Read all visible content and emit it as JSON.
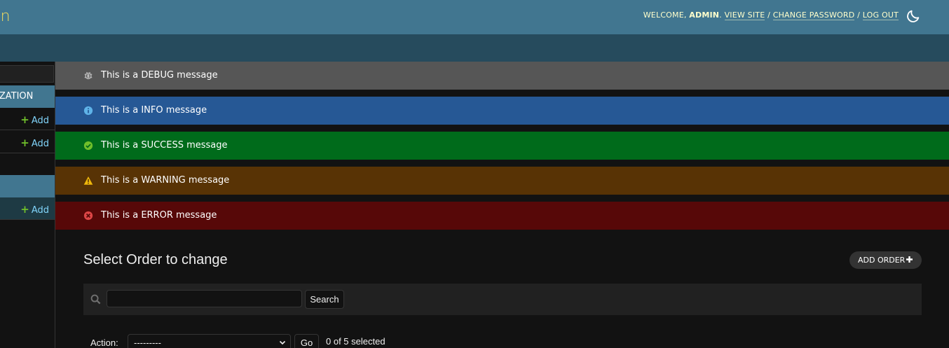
{
  "header": {
    "branding": "Django administration",
    "branding_visible": "ation",
    "welcome": "Welcome,",
    "username": "admin",
    "view_site": "View site",
    "change_password": "Change password",
    "log_out": "Log out",
    "separator": "/",
    "theme_icon": "moon-icon"
  },
  "sidebar": {
    "app_caption_1": "AUTHORIZATION",
    "app_caption_1_visible": "RIZATION",
    "add_label": "Add"
  },
  "messages": {
    "debug": "This is a DEBUG message",
    "info": "This is a INFO message",
    "success": "This is a SUCCESS message",
    "warning": "This is a WARNING message",
    "error": "This is a ERROR message"
  },
  "content": {
    "title": "Select Order to change",
    "add_button": "Add order",
    "search_button": "Search",
    "search_value": "",
    "action_label": "Action:",
    "action_selected": "---------",
    "go_button": "Go",
    "selected_count": "0 of 5 selected"
  },
  "colors": {
    "header_bg": "#417690",
    "breadcrumbs_bg": "#264b5d",
    "debug_bg": "#565656",
    "info_bg": "#265895",
    "success_bg": "#006b1b",
    "warning_bg": "#583305",
    "error_bg": "#570808",
    "branding": "#f5dd5d"
  }
}
